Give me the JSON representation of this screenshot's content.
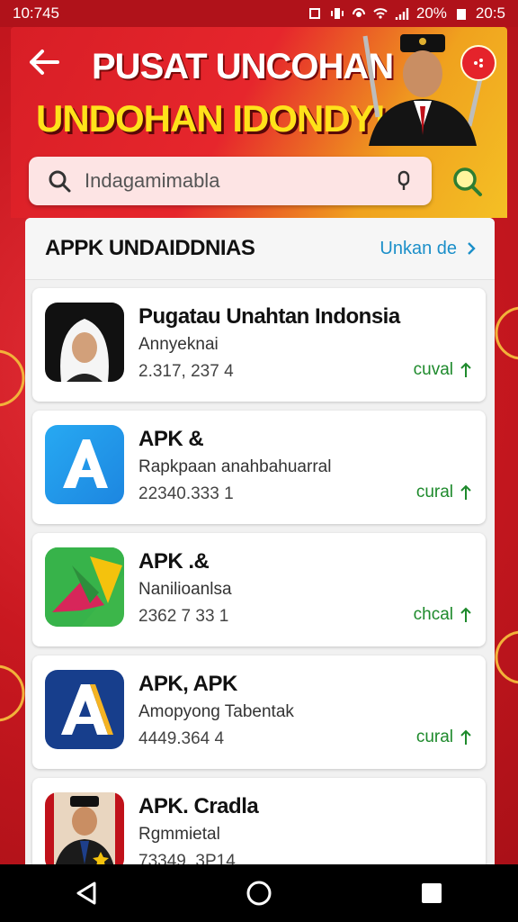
{
  "status_bar": {
    "time": "10:745",
    "battery": "20%",
    "clock_right": "20:5"
  },
  "header": {
    "title_line1": "PUSAT UNCOHAN",
    "title_line2": "UNDOHAN IDONDY!"
  },
  "search": {
    "value": "Indagamimabla"
  },
  "section": {
    "title": "APPK UNDAIDDNIAS",
    "link_label": "Unkan de"
  },
  "apps": [
    {
      "name": "Pugatau Unahtan Indonsia",
      "subtitle": "Annyeknai",
      "count": "2.317, 237 4",
      "action": "cuval",
      "icon": "person-hijab-icon"
    },
    {
      "name": "APK &",
      "subtitle": "Rapkpaan anahbahuarral",
      "count": "22340.333 1",
      "action": "cural",
      "icon": "letter-a-blue-icon"
    },
    {
      "name": "APK .&",
      "subtitle": "Nanilioanlsa",
      "count": "2362 7 33 1",
      "action": "chcal",
      "icon": "green-map-icon"
    },
    {
      "name": "APK, APK",
      "subtitle": "Amopyong Tabentak",
      "count": "4449.364 4",
      "action": "cural",
      "icon": "letter-a-navy-icon"
    },
    {
      "name": "APK. Cradla",
      "subtitle": "Rgmmietal",
      "count": "73349, 3P14",
      "action": "",
      "icon": "official-portrait-icon"
    }
  ],
  "colors": {
    "header_red": "#d81e26",
    "title_yellow": "#ffe21a",
    "link_blue": "#1b8fc9",
    "action_green": "#1e8a2c"
  }
}
